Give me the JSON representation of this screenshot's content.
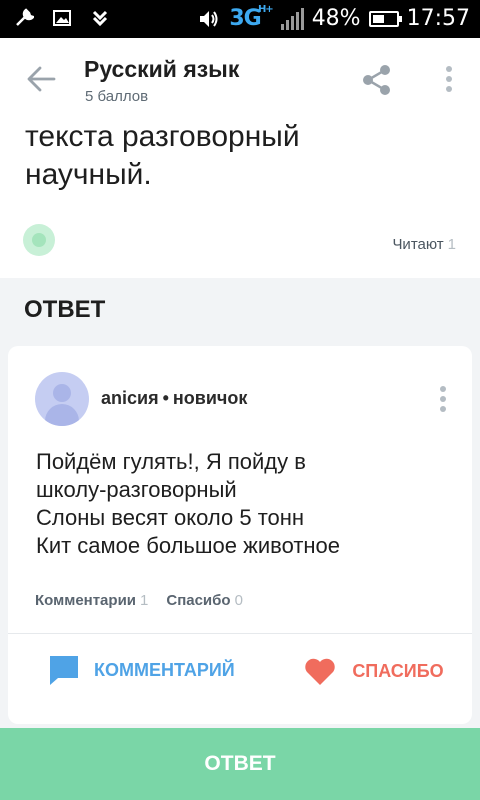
{
  "status_bar": {
    "network": "3G",
    "network_sup": "H+",
    "battery": "48%",
    "time": "17:57"
  },
  "header": {
    "subject": "Русский язык",
    "points": "5 баллов"
  },
  "question": {
    "text_lines": [
      "текста разговорный",
      "научный."
    ],
    "readers_label": "Читают",
    "readers_count": "1"
  },
  "answer_heading": "ОТВЕТ",
  "answer": {
    "author": "anicия",
    "rank": "новичок",
    "lines": [
      "Пойдём гулять!, Я пойду в",
      "школу-разговорный",
      "Слоны весят около 5 тонн",
      "Кит самое большое животное"
    ],
    "comments_label": "Комментарии",
    "comments_count": "1",
    "thanks_label": "Спасибо",
    "thanks_count": "0",
    "comment_button": "КОММЕНТАРИЙ",
    "thanks_button": "СПАСИБО"
  },
  "bottom_button": "ОТВЕТ",
  "colors": {
    "accent_green": "#7ad6a7",
    "accent_blue": "#4fa3e6",
    "accent_red": "#f06c5d"
  }
}
